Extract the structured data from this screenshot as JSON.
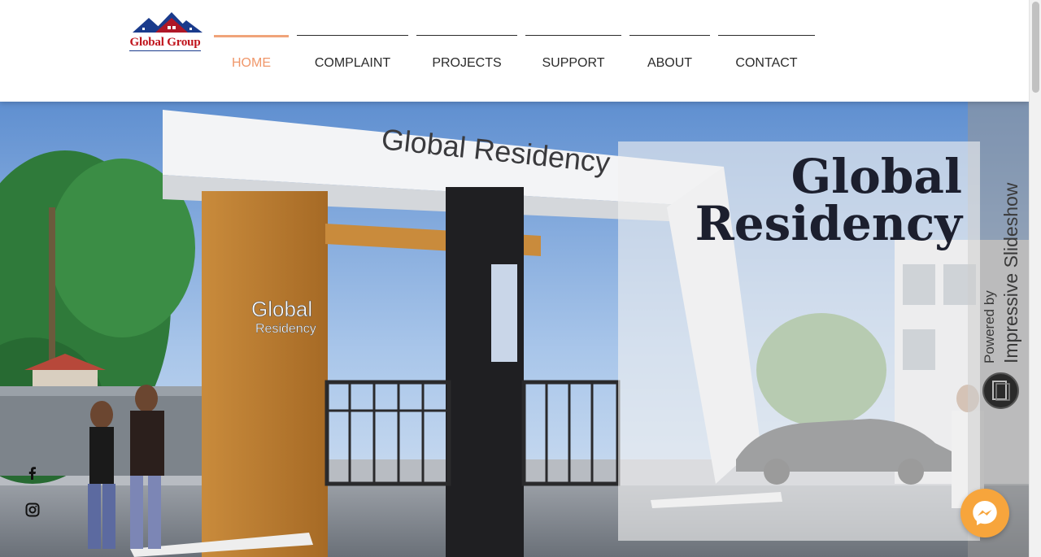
{
  "logo": {
    "text": "Global Group"
  },
  "nav": {
    "items": [
      {
        "label": "HOME"
      },
      {
        "label": "COMPLAINT"
      },
      {
        "label": "PROJECTS"
      },
      {
        "label": "SUPPORT"
      },
      {
        "label": "ABOUT"
      },
      {
        "label": "CONTACT"
      }
    ],
    "active_color": "#f0976a"
  },
  "hero": {
    "title_line1": "Global",
    "title_line2": "Residency",
    "sign_top": "Global Residency",
    "pillar_line1": "Global",
    "pillar_line2": "Residency"
  },
  "slideshow": {
    "powered_by": "Powered by",
    "brand": "Impressive Slideshow"
  },
  "social": {
    "icons": [
      "facebook-icon",
      "instagram-icon"
    ]
  },
  "chat": {
    "icon": "messenger-icon"
  }
}
